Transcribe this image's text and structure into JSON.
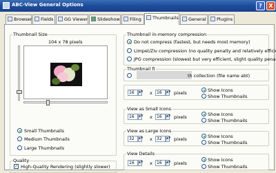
{
  "window": {
    "title": "ABC-View General Options",
    "help": "?",
    "close": "X"
  },
  "tabs": [
    {
      "label": "Browser"
    },
    {
      "label": "Fields"
    },
    {
      "label": "GG Viewer"
    },
    {
      "label": "Slideshow"
    },
    {
      "label": "Filing"
    },
    {
      "label": "Thumbnails"
    },
    {
      "label": "General"
    },
    {
      "label": "Plugins"
    }
  ],
  "thumbnail_size": {
    "legend": "Thumbnail Size",
    "caption": "104 x 78 pixels",
    "options": [
      "Small Thumbnails",
      "Medium Thumbnails",
      "Large Thumbnails"
    ]
  },
  "quality": {
    "legend": "Quality",
    "option": "High-Quality Rendering (slightly slower)"
  },
  "compression": {
    "legend": "Thumbnail in-memory compression",
    "options": [
      "Do not compress (fastest, but needs most memory)",
      "Limpel/Ziv compression (no quality penalty and relatively efficient)",
      "JPG compression (slowest but very efficient, slight quality penalty)"
    ]
  },
  "thumbnail_file": {
    "legend": "Thumbnail fi",
    "text": "th collection (file name abt)"
  },
  "views": [
    {
      "legend": "",
      "w": "16",
      "h": "16",
      "x": "x",
      "unit": "pixels",
      "opt1": "Show Icons",
      "opt2": "Show Thumbnails"
    },
    {
      "legend": "View as Small Icons",
      "w": "16",
      "h": "16",
      "x": "x",
      "unit": "pixels",
      "opt1": "Show Icons",
      "opt2": "Show Thumbnails"
    },
    {
      "legend": "View as Large Icons",
      "w": "32",
      "h": "32",
      "x": "x",
      "unit": "pixels",
      "opt1": "Show Icons",
      "opt2": "Show Thumbnails"
    },
    {
      "legend": "View Details",
      "w": "16",
      "h": "16",
      "x": "x",
      "unit": "pixels",
      "opt1": "Show Icons",
      "opt2": "Show Thumbnails"
    }
  ]
}
